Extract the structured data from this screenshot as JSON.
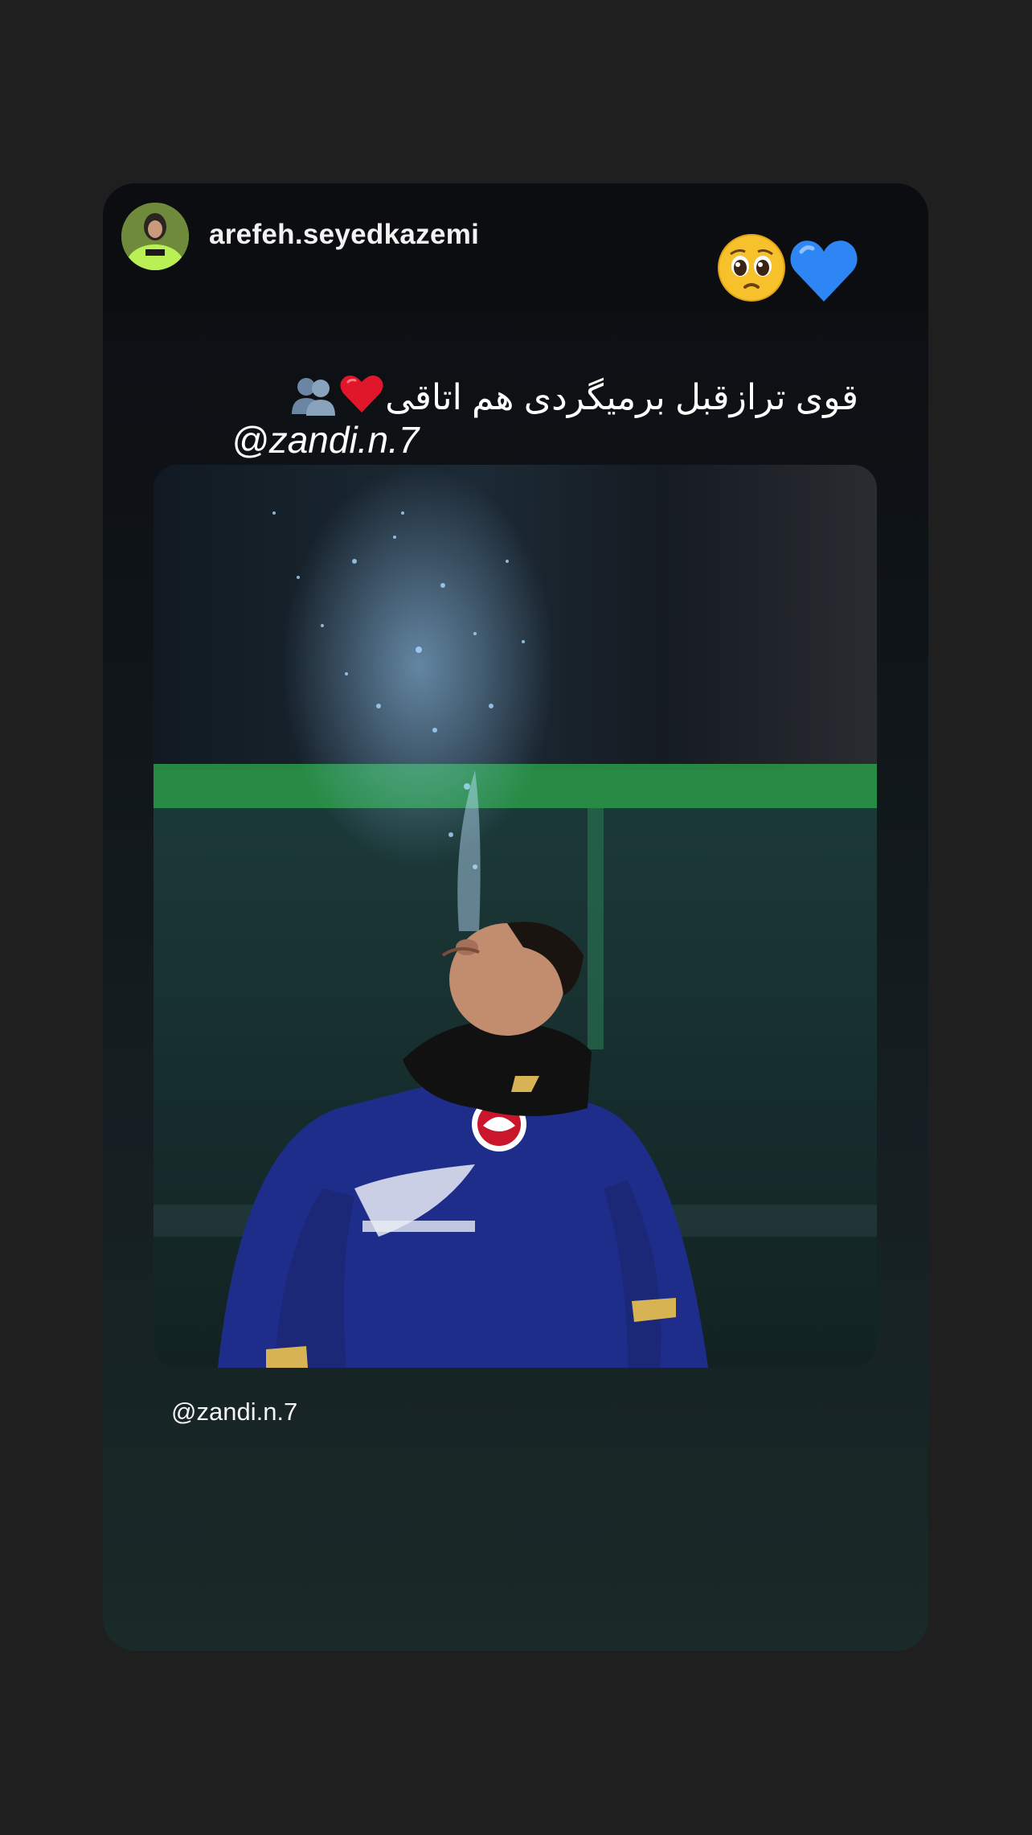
{
  "story": {
    "username": "arefeh.seyedkazemi",
    "emoji": [
      "pleading-face",
      "blue-heart"
    ],
    "caption": "قوی ترازقبل برمیگردی هم اتاقی",
    "caption_emoji": [
      "red-heart",
      "busts-in-silhouette"
    ],
    "mention_sticker": "@zandi.n.7",
    "repost_mention": "@zandi.n.7"
  },
  "colors": {
    "background": "#1f1f1f",
    "card_top": "#0c0e11",
    "card_bottom": "#192a28",
    "jersey": "#1f2d8a",
    "pitch_stripe": "#2a9a48"
  }
}
